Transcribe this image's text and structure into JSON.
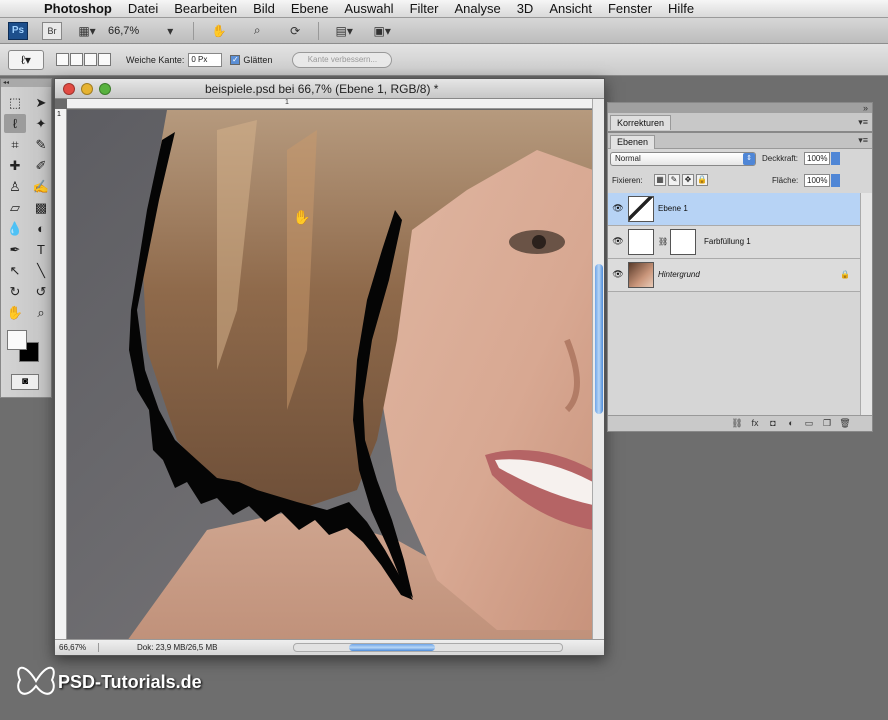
{
  "menubar": {
    "app": "Photoshop",
    "items": [
      "Datei",
      "Bearbeiten",
      "Bild",
      "Ebene",
      "Auswahl",
      "Filter",
      "Analyse",
      "3D",
      "Ansicht",
      "Fenster",
      "Hilfe"
    ]
  },
  "appbar": {
    "ps_label": "Ps",
    "br_label": "Br",
    "zoom": "66,7%"
  },
  "options": {
    "feather_label": "Weiche Kante:",
    "feather_value": "0 Px",
    "antialias_label": "Glätten",
    "antialias_checked": true,
    "refine_button": "Kante verbessern..."
  },
  "tools": {
    "items": [
      "marquee-tool",
      "move-tool",
      "lasso-tool",
      "magic-wand-tool",
      "crop-tool",
      "eyedropper-tool",
      "healing-tool",
      "brush-tool",
      "stamp-tool",
      "history-brush-tool",
      "eraser-tool",
      "gradient-tool",
      "blur-tool",
      "dodge-tool",
      "pen-tool",
      "type-tool",
      "path-select-tool",
      "shape-tool",
      "3d-rotate-tool",
      "3d-orbit-tool",
      "hand-tool",
      "zoom-tool"
    ],
    "active": "lasso-tool",
    "foreground_color": "#fafafa",
    "background_color": "#000000"
  },
  "document": {
    "title": "beispiele.psd bei 66,7% (Ebene 1, RGB/8) *",
    "ruler_top_mark": "1",
    "ruler_left_mark": "1",
    "status_zoom": "66,67%",
    "status_doc": "Dok: 23,9 MB/26,5 MB",
    "vertical_scroll": 0.42,
    "horizontal_scroll": 0.3
  },
  "panels": {
    "korrekturen_tab": "Korrekturen",
    "ebenen_tab": "Ebenen",
    "blend_mode": "Normal",
    "opacity_label": "Deckkraft:",
    "opacity_value": "100%",
    "lock_label": "Fixieren:",
    "fill_label": "Fläche:",
    "fill_value": "100%",
    "layers": [
      {
        "name": "Ebene 1",
        "selected": true
      },
      {
        "name": "Farbfüllung 1",
        "selected": false
      },
      {
        "name": "Hintergrund",
        "selected": false,
        "locked": true
      }
    ]
  },
  "colors": {
    "selected_layer": "#b7d3f5",
    "accent_blue": "#4f86d6"
  },
  "watermark": {
    "text": "PSD-Tutorials.de"
  }
}
